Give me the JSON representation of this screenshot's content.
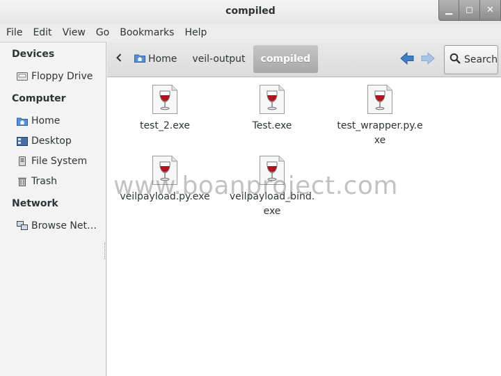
{
  "window": {
    "title": "compiled",
    "buttons": [
      "▁",
      "◻",
      "✕"
    ]
  },
  "menu": [
    "File",
    "Edit",
    "View",
    "Go",
    "Bookmarks",
    "Help"
  ],
  "sidebar": {
    "devices_heading": "Devices",
    "devices": [
      {
        "label": "Floppy Drive",
        "icon": "floppy-icon"
      }
    ],
    "computer_heading": "Computer",
    "computer": [
      {
        "label": "Home",
        "icon": "home-folder-icon"
      },
      {
        "label": "Desktop",
        "icon": "desktop-icon"
      },
      {
        "label": "File System",
        "icon": "drive-icon"
      },
      {
        "label": "Trash",
        "icon": "trash-icon"
      }
    ],
    "network_heading": "Network",
    "network": [
      {
        "label": "Browse Net…",
        "icon": "network-icon"
      }
    ]
  },
  "toolbar": {
    "breadcrumbs": [
      "Home",
      "veil-output",
      "compiled"
    ],
    "search_label": "Search"
  },
  "files": [
    {
      "name": "test_2.exe"
    },
    {
      "name": "Test.exe"
    },
    {
      "name": "test_wrapper.py.exe"
    },
    {
      "name": "veilpayload.py.exe"
    },
    {
      "name": "veilpayload_bind.exe"
    }
  ],
  "watermark": "www.boanproject.com",
  "colors": {
    "accent_blue": "#3f7fc4",
    "active_crumb": "#b4b4b4",
    "wine": "#b0151f"
  }
}
